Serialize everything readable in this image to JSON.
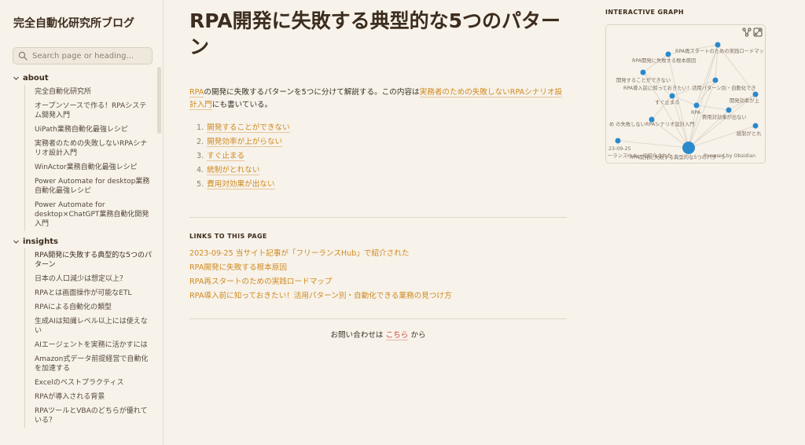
{
  "site": {
    "title": "完全自動化研究所ブログ"
  },
  "search": {
    "placeholder": "Search page or heading..."
  },
  "sidebar": {
    "folders": [
      {
        "name": "about",
        "items": [
          "完全自動化研究所",
          "オープンソースで作る！RPAシステム開発入門",
          "UiPath業務自動化最強レシピ",
          "実務者のための失敗しないRPAシナリオ設計入門",
          "WinActor業務自動化最強レシピ",
          "Power Automate for desktop業務自動化最強レシピ",
          "Power Automate for desktop×ChatGPT業務自動化開発入門"
        ]
      },
      {
        "name": "insights",
        "items": [
          "RPA開発に失敗する典型的な5つのパターン",
          "日本の人口減少は想定以上？",
          "RPAとは画面操作が可能なETL",
          "RPAによる自動化の類型",
          "生成AIは知識レベル以上には使えない",
          "AIエージェントを実務に活かすには",
          "Amazon式データ前提経営で自動化を加速する",
          "Excelのベストプラクティス",
          "RPAが導入される背景",
          "RPAツールとVBAのどちらが優れている？"
        ]
      }
    ]
  },
  "page": {
    "title": "RPA開発に失敗する典型的な5つのパターン",
    "intro": {
      "link1": "RPA",
      "text1": "の開発に失敗するパターンを5つに分けて解説する。この内容は",
      "link2": "実務者のための失敗しないRPAシナリオ設計入門",
      "text2": "にも書いている。"
    },
    "list": [
      {
        "num": "1.",
        "label": "開発することができない"
      },
      {
        "num": "2.",
        "label": "開発効率が上がらない"
      },
      {
        "num": "3.",
        "label": "すぐ止まる"
      },
      {
        "num": "4.",
        "label": "統制がとれない"
      },
      {
        "num": "5.",
        "label": "費用対効果が出ない"
      }
    ],
    "backlinks_title": "LINKS TO THIS PAGE",
    "backlinks": [
      "2023-09-25 当サイト記事が「フリーランスHub」で紹介された",
      "RPA開発に失敗する根本原因",
      "RPA再スタートのための実践ロードマップ",
      "RPA導入前に知っておきたい！活用パターン別・自動化できる業務の見つけ方"
    ],
    "footer": {
      "prefix": "お問い合わせは",
      "link": "こちら",
      "suffix": "から"
    }
  },
  "graph": {
    "title": "INTERACTIVE GRAPH",
    "node_color": "#2a8acb",
    "edge_color": "#ddd2c3",
    "labels": [
      "RPA再スタートのための実践ロードマップ",
      "RPA開発に失敗する根本原因",
      "開発することができない",
      "RPA導入前に知っておきたい！活用パターン別・自動化でき",
      "開発効率が上",
      "すぐ止まる",
      "RPA",
      "費用対効果が出ない",
      "め の失敗しないRPAシナリオ設計入門",
      "統制がとれ",
      "23-09-25",
      "ーランスHub」で紹介された",
      "RPA開発に失敗する典型的な5つのパターン",
      "Powered by Obsidian"
    ]
  }
}
